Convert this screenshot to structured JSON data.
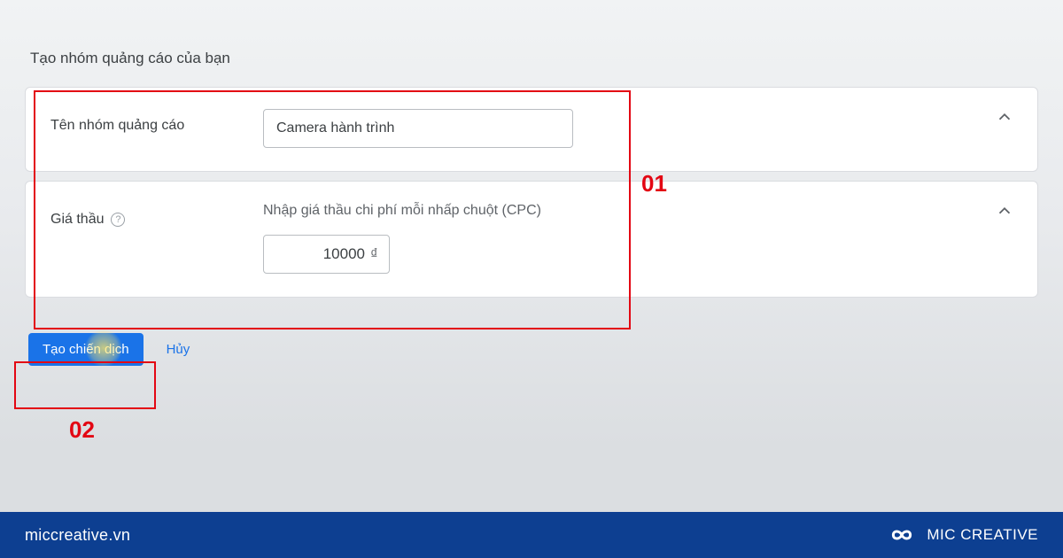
{
  "page": {
    "heading": "Tạo nhóm quảng cáo của bạn"
  },
  "adGroup": {
    "label": "Tên nhóm quảng cáo",
    "value": "Camera hành trình"
  },
  "bid": {
    "label": "Giá thầu",
    "helper": "Nhập giá thầu chi phí mỗi nhấp chuột (CPC)",
    "value": "10000",
    "currency": "₫"
  },
  "actions": {
    "create": "Tạo chiến dịch",
    "cancel": "Hủy"
  },
  "annotations": {
    "step1": "01",
    "step2": "02"
  },
  "footer": {
    "site": "miccreative.vn",
    "brand": "MIC CREATIVE"
  }
}
